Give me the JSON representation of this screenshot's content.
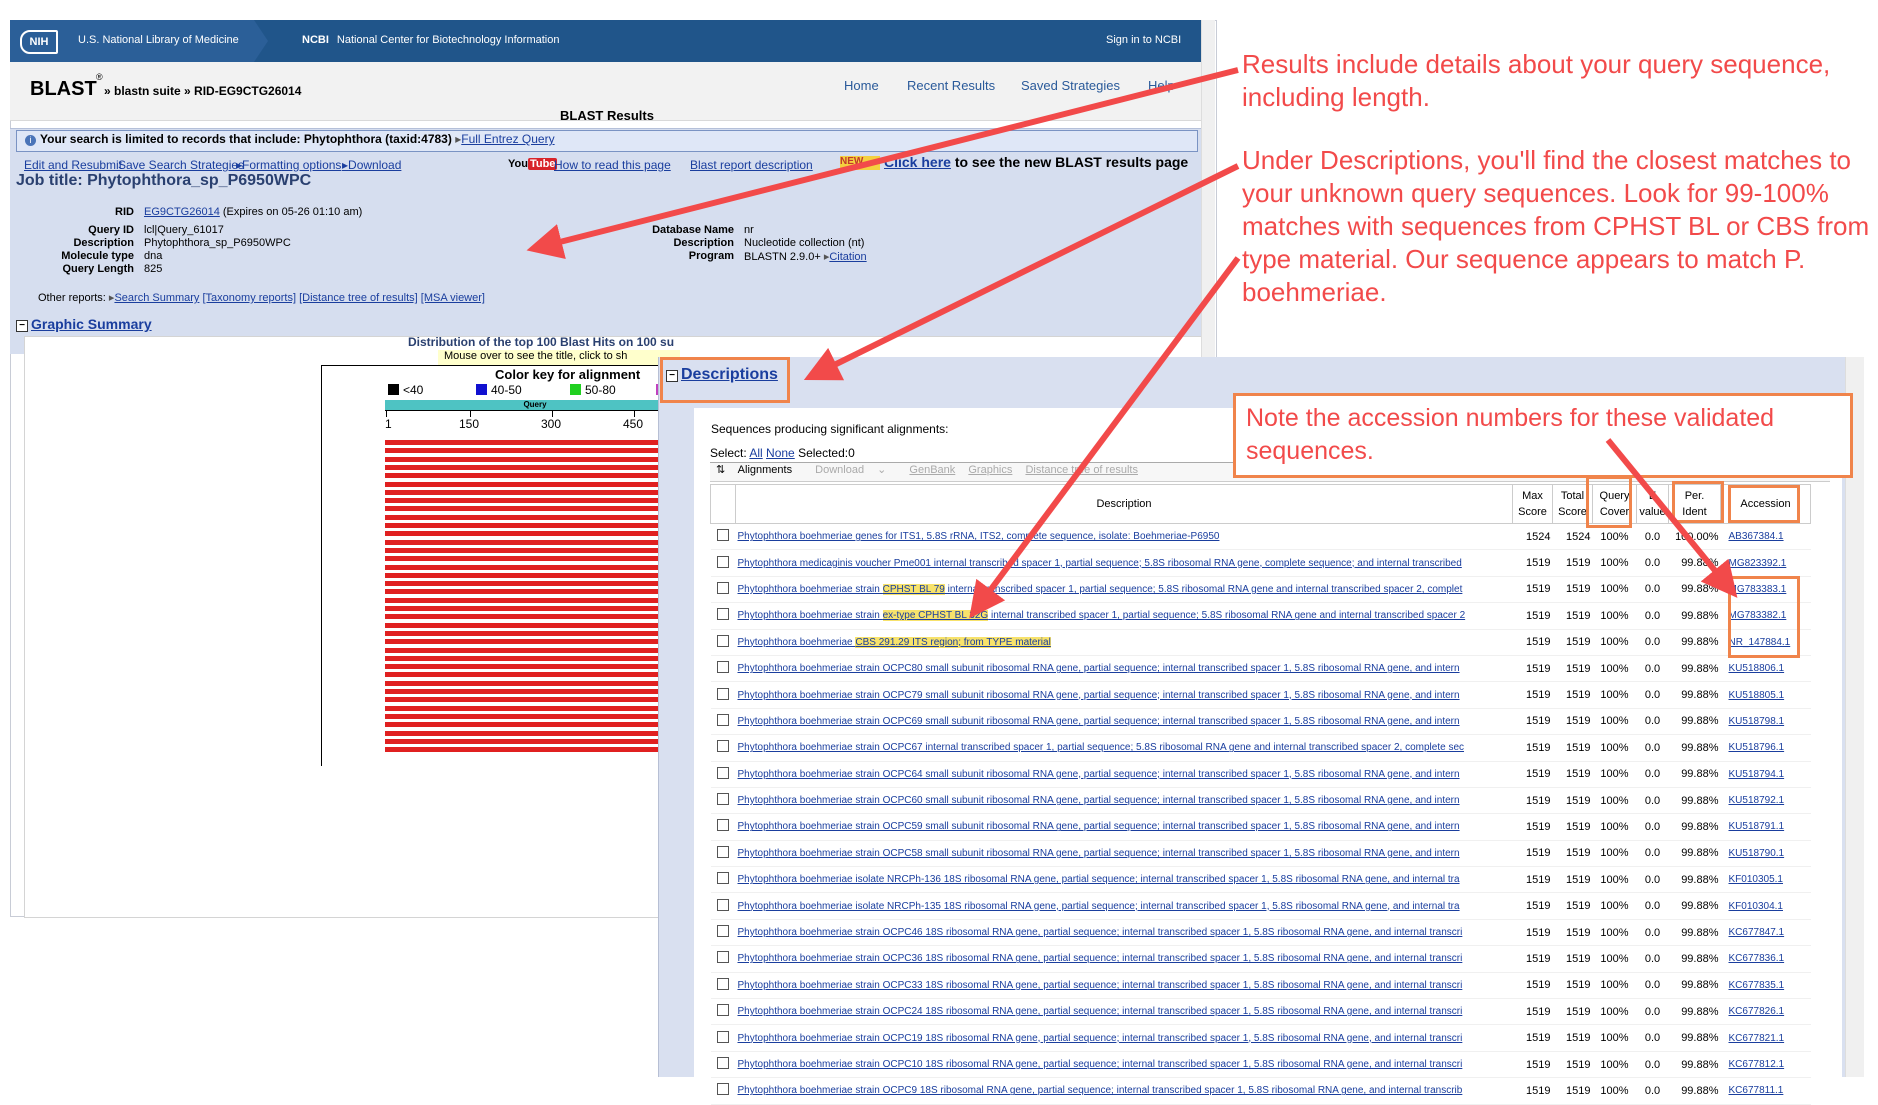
{
  "ncbi": {
    "nih_logo": "NIH",
    "nlm": "U.S. National Library of Medicine",
    "ncbi_short": "NCBI",
    "ncbi_full": "National Center for Biotechnology Information",
    "sign_in": "Sign in to NCBI"
  },
  "blast": {
    "logo": "BLAST",
    "reg": "®",
    "crumbs": "» blastn suite » RID-EG9CTG26014",
    "nav": [
      "Home",
      "Recent Results",
      "Saved Strategies",
      "Help"
    ],
    "results_title": "BLAST Results"
  },
  "limit": {
    "text": "Your search is limited to records that include: Phytophthora (taxid:4783)",
    "link": "Full Entrez Query"
  },
  "toolbar": {
    "edit": "Edit and Resubmit",
    "save": "Save Search Strategies",
    "formatting": "Formatting options",
    "download": "Download",
    "yt_you": "You",
    "yt_tube": "Tube",
    "how_to": "How to read this page",
    "report_desc": "Blast report description",
    "new_badge": "NEW",
    "click_here": "Click here",
    "click_rest": " to see the new BLAST results page"
  },
  "job": {
    "title": "Job title: Phytophthora_sp_P6950WPC",
    "rid_label": "RID",
    "rid": "EG9CTG26014",
    "expires": "(Expires on 05-26 01:10 am)",
    "query_id_label": "Query ID",
    "query_id": "lcl|Query_61017",
    "description_label": "Description",
    "description": "Phytophthora_sp_P6950WPC",
    "molecule_label": "Molecule type",
    "molecule": "dna",
    "length_label": "Query Length",
    "length": "825",
    "db_label": "Database Name",
    "db": "nr",
    "db_desc_label": "Description",
    "db_desc": "Nucleotide collection (nt)",
    "program_label": "Program",
    "program": "BLASTN 2.9.0+",
    "citation": "Citation",
    "other_reports_label": "Other reports:",
    "other_reports": [
      "Search Summary",
      "[Taxonomy reports]",
      "[Distance tree of results]",
      "[MSA viewer]"
    ]
  },
  "graphic": {
    "title": "Graphic Summary",
    "dist_title": "Distribution of the top 100 Blast Hits on 100 su",
    "mouse_over": "Mouse over to see the title, click to sh",
    "key_title": "Color key for alignment",
    "key_items": [
      {
        "label": "<40",
        "color": "#000000"
      },
      {
        "label": "40-50",
        "color": "#1010d0"
      },
      {
        "label": "50-80",
        "color": "#20d020"
      },
      {
        "label": "",
        "color": "#c040c0"
      }
    ],
    "query_label": "Query",
    "ticks": [
      "1",
      "150",
      "300",
      "450"
    ],
    "hit_bar_color": "#e02020"
  },
  "descriptions": {
    "title": "Descriptions",
    "seq_producing": "Sequences producing significant alignments:",
    "select_label": "Select:",
    "select_all": "All",
    "select_none": "None",
    "selected": "Selected:0",
    "tb_alignments": "Alignments",
    "tb_download": "Download",
    "tb_genbank": "GenBank",
    "tb_graphics": "Graphics",
    "tb_tree": "Distance tree of results",
    "headers": {
      "description": "Description",
      "max1": "Max",
      "max2": "Score",
      "total1": "Total",
      "total2": "Score",
      "qc1": "Query",
      "qc2": "Cover",
      "ev1": "E",
      "ev2": "value",
      "pi1": "Per.",
      "pi2": "Ident",
      "accession": "Accession"
    },
    "rows": [
      {
        "pre": "Phytophthora boehmeriae genes for ITS1, 5.8S rRNA, ITS2, complete sequence, isolate: Boehmeriae-P6950",
        "hl": "",
        "post": "",
        "max": "1524",
        "total": "1524",
        "qc": "100%",
        "ev": "0.0",
        "pi": "100.00%",
        "acc": "AB367384.1"
      },
      {
        "pre": "Phytophthora medicaginis voucher Pme001 internal transcribed spacer 1, partial sequence; 5.8S ribosomal RNA gene, complete sequence; and internal transcribed",
        "hl": "",
        "post": "",
        "max": "1519",
        "total": "1519",
        "qc": "100%",
        "ev": "0.0",
        "pi": "99.88%",
        "acc": "MG823392.1"
      },
      {
        "pre": "Phytophthora boehmeriae strain ",
        "hl": "CPHST BL 79",
        "post": " internal transcribed spacer 1, partial sequence; 5.8S ribosomal RNA gene and internal transcribed spacer 2, complet",
        "max": "1519",
        "total": "1519",
        "qc": "100%",
        "ev": "0.0",
        "pi": "99.88%",
        "acc": "MG783383.1"
      },
      {
        "pre": "Phytophthora boehmeriae strain ",
        "hl": "ex-type CPHST BL 32G",
        "post": " internal transcribed spacer 1, partial sequence; 5.8S ribosomal RNA gene and internal transcribed spacer 2",
        "max": "1519",
        "total": "1519",
        "qc": "100%",
        "ev": "0.0",
        "pi": "99.88%",
        "acc": "MG783382.1"
      },
      {
        "pre": "Phytophthora boehmeriae ",
        "hl": "CBS 291.29 ITS region; from TYPE material",
        "post": "",
        "max": "1519",
        "total": "1519",
        "qc": "100%",
        "ev": "0.0",
        "pi": "99.88%",
        "acc": "NR_147884.1"
      },
      {
        "pre": "Phytophthora boehmeriae strain OCPC80 small subunit ribosomal RNA gene, partial sequence; internal transcribed spacer 1, 5.8S ribosomal RNA gene, and intern",
        "hl": "",
        "post": "",
        "max": "1519",
        "total": "1519",
        "qc": "100%",
        "ev": "0.0",
        "pi": "99.88%",
        "acc": "KU518806.1"
      },
      {
        "pre": "Phytophthora boehmeriae strain OCPC79 small subunit ribosomal RNA gene, partial sequence; internal transcribed spacer 1, 5.8S ribosomal RNA gene, and intern",
        "hl": "",
        "post": "",
        "max": "1519",
        "total": "1519",
        "qc": "100%",
        "ev": "0.0",
        "pi": "99.88%",
        "acc": "KU518805.1"
      },
      {
        "pre": "Phytophthora boehmeriae strain OCPC69 small subunit ribosomal RNA gene, partial sequence; internal transcribed spacer 1, 5.8S ribosomal RNA gene, and intern",
        "hl": "",
        "post": "",
        "max": "1519",
        "total": "1519",
        "qc": "100%",
        "ev": "0.0",
        "pi": "99.88%",
        "acc": "KU518798.1"
      },
      {
        "pre": "Phytophthora boehmeriae strain OCPC67 internal transcribed spacer 1, partial sequence; 5.8S ribosomal RNA gene and internal transcribed spacer 2, complete sec",
        "hl": "",
        "post": "",
        "max": "1519",
        "total": "1519",
        "qc": "100%",
        "ev": "0.0",
        "pi": "99.88%",
        "acc": "KU518796.1"
      },
      {
        "pre": "Phytophthora boehmeriae strain OCPC64 small subunit ribosomal RNA gene, partial sequence; internal transcribed spacer 1, 5.8S ribosomal RNA gene, and intern",
        "hl": "",
        "post": "",
        "max": "1519",
        "total": "1519",
        "qc": "100%",
        "ev": "0.0",
        "pi": "99.88%",
        "acc": "KU518794.1"
      },
      {
        "pre": "Phytophthora boehmeriae strain OCPC60 small subunit ribosomal RNA gene, partial sequence; internal transcribed spacer 1, 5.8S ribosomal RNA gene, and intern",
        "hl": "",
        "post": "",
        "max": "1519",
        "total": "1519",
        "qc": "100%",
        "ev": "0.0",
        "pi": "99.88%",
        "acc": "KU518792.1"
      },
      {
        "pre": "Phytophthora boehmeriae strain OCPC59 small subunit ribosomal RNA gene, partial sequence; internal transcribed spacer 1, 5.8S ribosomal RNA gene, and intern",
        "hl": "",
        "post": "",
        "max": "1519",
        "total": "1519",
        "qc": "100%",
        "ev": "0.0",
        "pi": "99.88%",
        "acc": "KU518791.1"
      },
      {
        "pre": "Phytophthora boehmeriae strain OCPC58 small subunit ribosomal RNA gene, partial sequence; internal transcribed spacer 1, 5.8S ribosomal RNA gene, and intern",
        "hl": "",
        "post": "",
        "max": "1519",
        "total": "1519",
        "qc": "100%",
        "ev": "0.0",
        "pi": "99.88%",
        "acc": "KU518790.1"
      },
      {
        "pre": "Phytophthora boehmeriae isolate NRCPh-136 18S ribosomal RNA gene, partial sequence; internal transcribed spacer 1, 5.8S ribosomal RNA gene, and internal tra",
        "hl": "",
        "post": "",
        "max": "1519",
        "total": "1519",
        "qc": "100%",
        "ev": "0.0",
        "pi": "99.88%",
        "acc": "KF010305.1"
      },
      {
        "pre": "Phytophthora boehmeriae isolate NRCPh-135 18S ribosomal RNA gene, partial sequence; internal transcribed spacer 1, 5.8S ribosomal RNA gene, and internal tra",
        "hl": "",
        "post": "",
        "max": "1519",
        "total": "1519",
        "qc": "100%",
        "ev": "0.0",
        "pi": "99.88%",
        "acc": "KF010304.1"
      },
      {
        "pre": "Phytophthora boehmeriae strain OCPC46 18S ribosomal RNA gene, partial sequence; internal transcribed spacer 1, 5.8S ribosomal RNA gene, and internal transcri",
        "hl": "",
        "post": "",
        "max": "1519",
        "total": "1519",
        "qc": "100%",
        "ev": "0.0",
        "pi": "99.88%",
        "acc": "KC677847.1"
      },
      {
        "pre": "Phytophthora boehmeriae strain OCPC36 18S ribosomal RNA gene, partial sequence; internal transcribed spacer 1, 5.8S ribosomal RNA gene, and internal transcri",
        "hl": "",
        "post": "",
        "max": "1519",
        "total": "1519",
        "qc": "100%",
        "ev": "0.0",
        "pi": "99.88%",
        "acc": "KC677836.1"
      },
      {
        "pre": "Phytophthora boehmeriae strain OCPC33 18S ribosomal RNA gene, partial sequence; internal transcribed spacer 1, 5.8S ribosomal RNA gene, and internal transcri",
        "hl": "",
        "post": "",
        "max": "1519",
        "total": "1519",
        "qc": "100%",
        "ev": "0.0",
        "pi": "99.88%",
        "acc": "KC677835.1"
      },
      {
        "pre": "Phytophthora boehmeriae strain OCPC24 18S ribosomal RNA gene, partial sequence; internal transcribed spacer 1, 5.8S ribosomal RNA gene, and internal transcri",
        "hl": "",
        "post": "",
        "max": "1519",
        "total": "1519",
        "qc": "100%",
        "ev": "0.0",
        "pi": "99.88%",
        "acc": "KC677826.1"
      },
      {
        "pre": "Phytophthora boehmeriae strain OCPC19 18S ribosomal RNA gene, partial sequence; internal transcribed spacer 1, 5.8S ribosomal RNA gene, and internal transcri",
        "hl": "",
        "post": "",
        "max": "1519",
        "total": "1519",
        "qc": "100%",
        "ev": "0.0",
        "pi": "99.88%",
        "acc": "KC677821.1"
      },
      {
        "pre": "Phytophthora boehmeriae strain OCPC10 18S ribosomal RNA gene, partial sequence; internal transcribed spacer 1, 5.8S ribosomal RNA gene, and internal transcri",
        "hl": "",
        "post": "",
        "max": "1519",
        "total": "1519",
        "qc": "100%",
        "ev": "0.0",
        "pi": "99.88%",
        "acc": "KC677812.1"
      },
      {
        "pre": "Phytophthora boehmeriae strain OCPC9 18S ribosomal RNA gene, partial sequence; internal transcribed spacer 1, 5.8S ribosomal RNA gene, and internal transcrib",
        "hl": "",
        "post": "",
        "max": "1519",
        "total": "1519",
        "qc": "100%",
        "ev": "0.0",
        "pi": "99.88%",
        "acc": "KC677811.1"
      }
    ]
  },
  "annotations": {
    "a1": "Results include details about your query sequence, including length.",
    "a2": "Under Descriptions, you'll find the closest matches to your unknown query sequences. Look for 99-100% matches with sequences from CPHST BL or CBS from type material. Our sequence appears to match P. boehmeriae.",
    "a3": "Note the accession numbers for these validated sequences.",
    "color": "#f24a4a",
    "box_color": "#f0844b"
  }
}
